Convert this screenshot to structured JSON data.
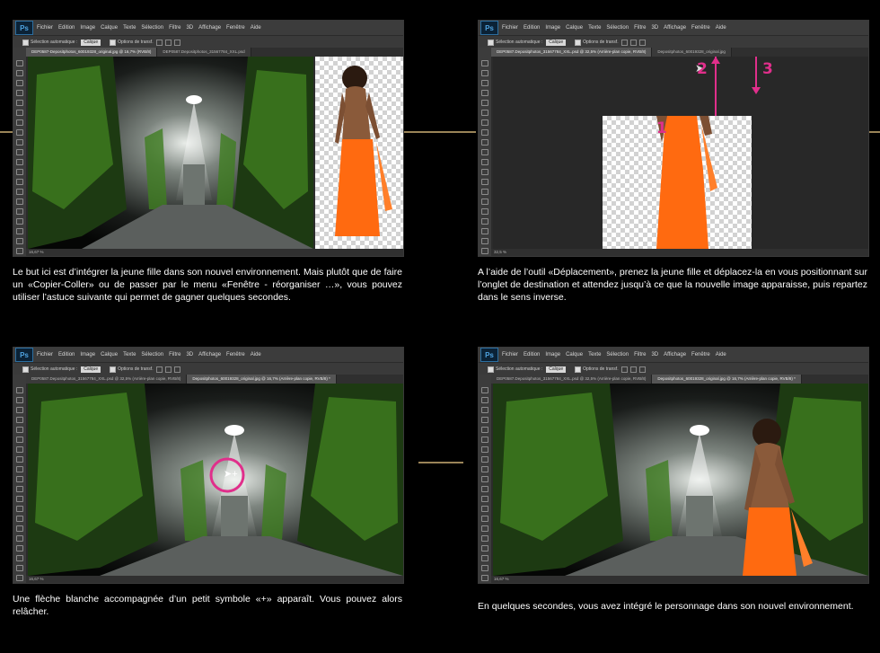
{
  "menu": {
    "ps_logo": "Ps",
    "items": [
      "Fichier",
      "Edition",
      "Image",
      "Calque",
      "Texte",
      "Sélection",
      "Filtre",
      "3D",
      "Affichage",
      "Fenêtre",
      "Aide"
    ]
  },
  "options": {
    "auto_select": "Sélection automatique :",
    "layer_select": "Calque",
    "transform": "Options de transf."
  },
  "panels": [
    {
      "tabs": [
        {
          "label": "DEP0587-Depositphotos_60019328_original.jpg @ 16,7% (RVB/8)",
          "active": true
        },
        {
          "label": "DEP0587.Depositphotos_31567784_XXL.psd",
          "active": false
        }
      ],
      "status": "16,67 %",
      "caption": "Le but ici est d’intégrer la jeune fille dans son nouvel environnement. Mais plutôt que de faire un «Copier-Coller» ou de passer par le menu «Fenêtre - réorganiser …», vous pouvez utiliser l’astuce suivante qui permet de gagner quelques secondes."
    },
    {
      "tabs": [
        {
          "label": "DEP0587.Depositphotos_31567784_XXL.psd @ 32,5% (Arrière-plan copie, RVB/8)",
          "active": true
        },
        {
          "label": "Depositphotos_60019328_original.jpg",
          "active": false
        }
      ],
      "status": "32,5 %",
      "numbers": [
        "1",
        "2",
        "3"
      ],
      "caption": "A l’aide de l’outil «Déplacement», prenez la jeune fille et déplacez-la en vous positionnant sur l’onglet de destination et attendez jusqu’à ce que la nouvelle image apparaisse, puis repartez dans le sens inverse."
    },
    {
      "tabs": [
        {
          "label": "DEP0587.Depositphotos_31567784_XXL.psd @ 32,5% (Arrière-plan copie, RVB/8)",
          "active": false
        },
        {
          "label": "Depositphotos_60019328_original.jpg @ 16,7% (Arrière-plan copie, RVB/8) *",
          "active": true
        }
      ],
      "status": "16,67 %",
      "caption": "Une flèche blanche accompagnée d’un petit symbole «+» apparaît. Vous pouvez alors relâcher."
    },
    {
      "tabs": [
        {
          "label": "DEP0587.Depositphotos_31567784_XXL.psd @ 32,5% (Arrière-plan copie, RVB/8)",
          "active": false
        },
        {
          "label": "Depositphotos_60019328_original.jpg @ 16,7% (Arrière-plan copie, RVB/8) *",
          "active": true
        }
      ],
      "status": "16,67 %",
      "caption": "En quelques secondes, vous avez intégré le personnage dans son nouvel environnement."
    }
  ],
  "colors": {
    "accent_rule": "#9a8458",
    "annotation": "#e02f8b",
    "dress": "#ff6a10"
  }
}
